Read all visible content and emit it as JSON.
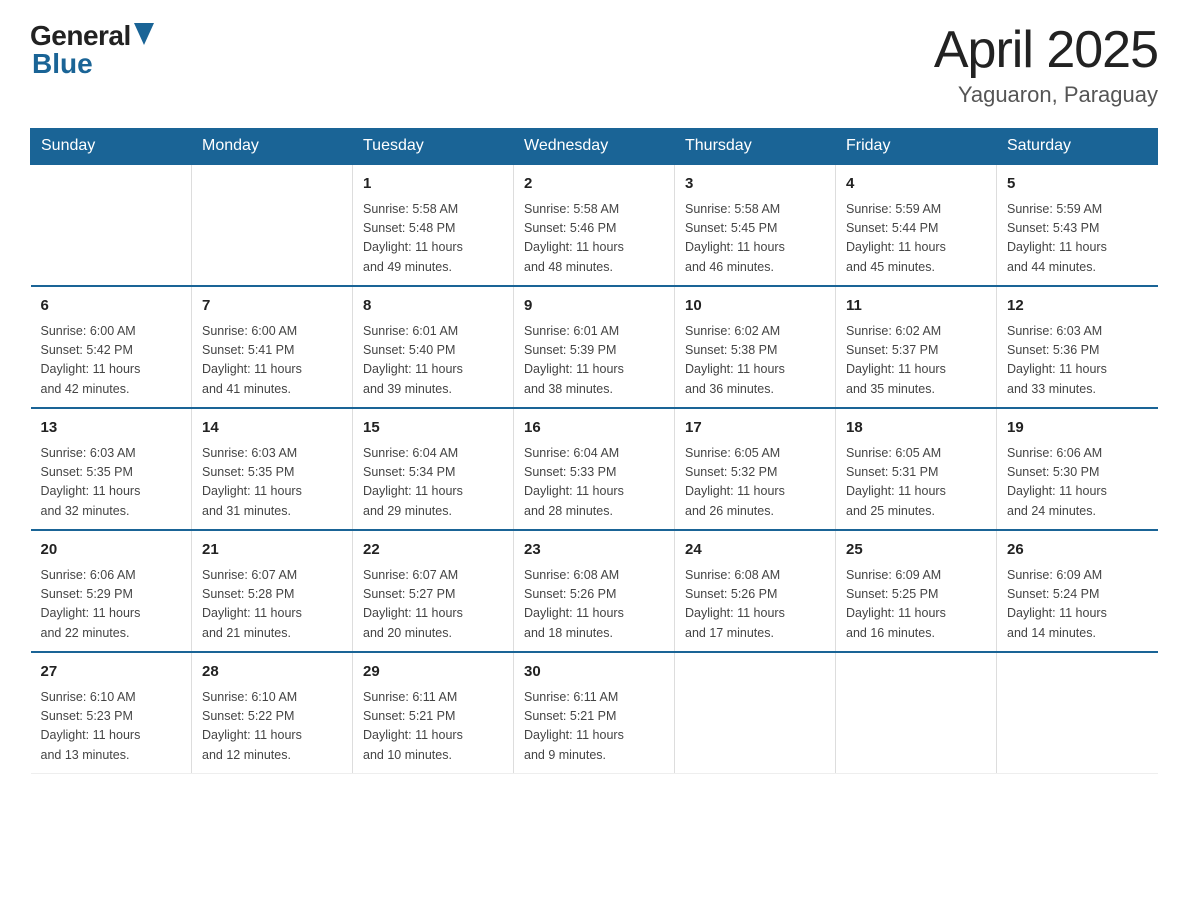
{
  "logo": {
    "general": "General",
    "blue": "Blue"
  },
  "title": {
    "month_year": "April 2025",
    "location": "Yaguaron, Paraguay"
  },
  "weekdays": [
    "Sunday",
    "Monday",
    "Tuesday",
    "Wednesday",
    "Thursday",
    "Friday",
    "Saturday"
  ],
  "weeks": [
    [
      {
        "day": "",
        "info": ""
      },
      {
        "day": "",
        "info": ""
      },
      {
        "day": "1",
        "info": "Sunrise: 5:58 AM\nSunset: 5:48 PM\nDaylight: 11 hours\nand 49 minutes."
      },
      {
        "day": "2",
        "info": "Sunrise: 5:58 AM\nSunset: 5:46 PM\nDaylight: 11 hours\nand 48 minutes."
      },
      {
        "day": "3",
        "info": "Sunrise: 5:58 AM\nSunset: 5:45 PM\nDaylight: 11 hours\nand 46 minutes."
      },
      {
        "day": "4",
        "info": "Sunrise: 5:59 AM\nSunset: 5:44 PM\nDaylight: 11 hours\nand 45 minutes."
      },
      {
        "day": "5",
        "info": "Sunrise: 5:59 AM\nSunset: 5:43 PM\nDaylight: 11 hours\nand 44 minutes."
      }
    ],
    [
      {
        "day": "6",
        "info": "Sunrise: 6:00 AM\nSunset: 5:42 PM\nDaylight: 11 hours\nand 42 minutes."
      },
      {
        "day": "7",
        "info": "Sunrise: 6:00 AM\nSunset: 5:41 PM\nDaylight: 11 hours\nand 41 minutes."
      },
      {
        "day": "8",
        "info": "Sunrise: 6:01 AM\nSunset: 5:40 PM\nDaylight: 11 hours\nand 39 minutes."
      },
      {
        "day": "9",
        "info": "Sunrise: 6:01 AM\nSunset: 5:39 PM\nDaylight: 11 hours\nand 38 minutes."
      },
      {
        "day": "10",
        "info": "Sunrise: 6:02 AM\nSunset: 5:38 PM\nDaylight: 11 hours\nand 36 minutes."
      },
      {
        "day": "11",
        "info": "Sunrise: 6:02 AM\nSunset: 5:37 PM\nDaylight: 11 hours\nand 35 minutes."
      },
      {
        "day": "12",
        "info": "Sunrise: 6:03 AM\nSunset: 5:36 PM\nDaylight: 11 hours\nand 33 minutes."
      }
    ],
    [
      {
        "day": "13",
        "info": "Sunrise: 6:03 AM\nSunset: 5:35 PM\nDaylight: 11 hours\nand 32 minutes."
      },
      {
        "day": "14",
        "info": "Sunrise: 6:03 AM\nSunset: 5:35 PM\nDaylight: 11 hours\nand 31 minutes."
      },
      {
        "day": "15",
        "info": "Sunrise: 6:04 AM\nSunset: 5:34 PM\nDaylight: 11 hours\nand 29 minutes."
      },
      {
        "day": "16",
        "info": "Sunrise: 6:04 AM\nSunset: 5:33 PM\nDaylight: 11 hours\nand 28 minutes."
      },
      {
        "day": "17",
        "info": "Sunrise: 6:05 AM\nSunset: 5:32 PM\nDaylight: 11 hours\nand 26 minutes."
      },
      {
        "day": "18",
        "info": "Sunrise: 6:05 AM\nSunset: 5:31 PM\nDaylight: 11 hours\nand 25 minutes."
      },
      {
        "day": "19",
        "info": "Sunrise: 6:06 AM\nSunset: 5:30 PM\nDaylight: 11 hours\nand 24 minutes."
      }
    ],
    [
      {
        "day": "20",
        "info": "Sunrise: 6:06 AM\nSunset: 5:29 PM\nDaylight: 11 hours\nand 22 minutes."
      },
      {
        "day": "21",
        "info": "Sunrise: 6:07 AM\nSunset: 5:28 PM\nDaylight: 11 hours\nand 21 minutes."
      },
      {
        "day": "22",
        "info": "Sunrise: 6:07 AM\nSunset: 5:27 PM\nDaylight: 11 hours\nand 20 minutes."
      },
      {
        "day": "23",
        "info": "Sunrise: 6:08 AM\nSunset: 5:26 PM\nDaylight: 11 hours\nand 18 minutes."
      },
      {
        "day": "24",
        "info": "Sunrise: 6:08 AM\nSunset: 5:26 PM\nDaylight: 11 hours\nand 17 minutes."
      },
      {
        "day": "25",
        "info": "Sunrise: 6:09 AM\nSunset: 5:25 PM\nDaylight: 11 hours\nand 16 minutes."
      },
      {
        "day": "26",
        "info": "Sunrise: 6:09 AM\nSunset: 5:24 PM\nDaylight: 11 hours\nand 14 minutes."
      }
    ],
    [
      {
        "day": "27",
        "info": "Sunrise: 6:10 AM\nSunset: 5:23 PM\nDaylight: 11 hours\nand 13 minutes."
      },
      {
        "day": "28",
        "info": "Sunrise: 6:10 AM\nSunset: 5:22 PM\nDaylight: 11 hours\nand 12 minutes."
      },
      {
        "day": "29",
        "info": "Sunrise: 6:11 AM\nSunset: 5:21 PM\nDaylight: 11 hours\nand 10 minutes."
      },
      {
        "day": "30",
        "info": "Sunrise: 6:11 AM\nSunset: 5:21 PM\nDaylight: 11 hours\nand 9 minutes."
      },
      {
        "day": "",
        "info": ""
      },
      {
        "day": "",
        "info": ""
      },
      {
        "day": "",
        "info": ""
      }
    ]
  ]
}
